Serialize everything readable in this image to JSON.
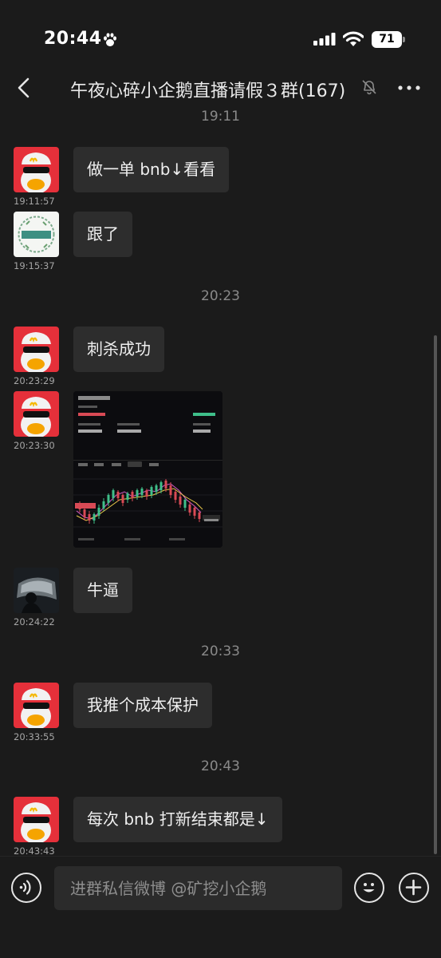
{
  "status_bar": {
    "time": "20:44",
    "battery": "71"
  },
  "header": {
    "title": "午夜心碎小企鹅直播请假３群(167)"
  },
  "time_separators": [
    "19:11",
    "20:23",
    "20:33",
    "20:43"
  ],
  "messages": [
    {
      "text": "做一单 bnb↓看看",
      "time": "19:11:57"
    },
    {
      "text": "跟了",
      "time": "19:15:37"
    },
    {
      "text": "刺杀成功",
      "time": "20:23:29"
    },
    {
      "text": "",
      "time": "20:23:30"
    },
    {
      "text": "牛逼",
      "time": "20:24:22"
    },
    {
      "text": "我推个成本保护",
      "time": "20:33:55"
    },
    {
      "text": "每次 bnb 打新结束都是↓",
      "time": "20:43:43"
    }
  ],
  "input": {
    "placeholder": "进群私信微博 @矿挖小企鹅"
  },
  "colors": {
    "background": "#1b1b1b",
    "bubble": "#2d2d2d",
    "avatar_red": "#e5303a"
  },
  "icons": [
    "paw-icon",
    "signal-icon",
    "wifi-icon",
    "back-icon",
    "mute-icon",
    "more-icon",
    "voice-icon",
    "emoji-icon",
    "plus-icon"
  ]
}
